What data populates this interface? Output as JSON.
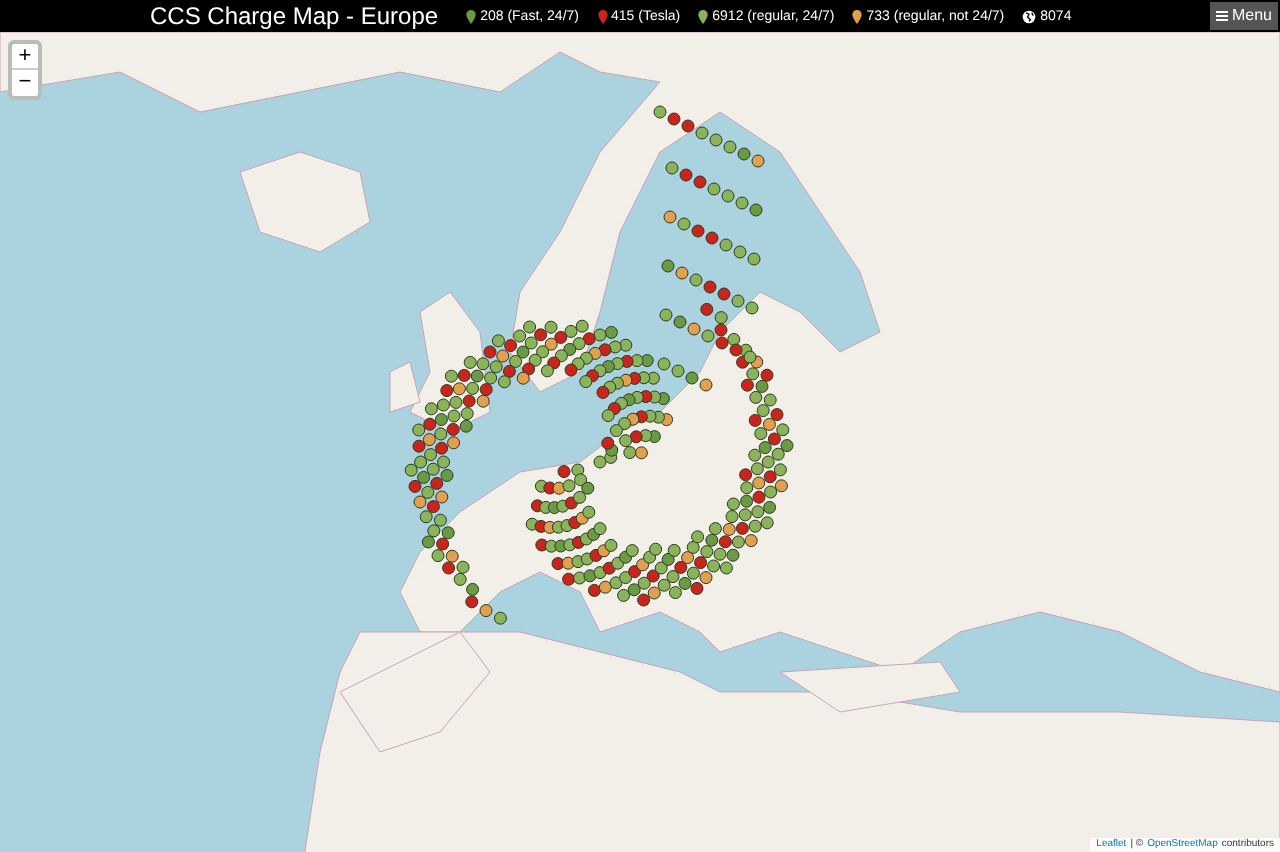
{
  "header": {
    "title": "CCS Charge Map - Europe",
    "legend": [
      {
        "kind": "pin",
        "color": "#6b9a45",
        "label": "208 (Fast, 24/7)"
      },
      {
        "kind": "pin",
        "color": "#c9251c",
        "label": "415 (Tesla)"
      },
      {
        "kind": "pin",
        "color": "#8bb35a",
        "label": "6912 (regular, 24/7)"
      },
      {
        "kind": "pin",
        "color": "#e0a050",
        "label": "733 (regular, not 24/7)"
      },
      {
        "kind": "globe",
        "color": "#ffffff",
        "label": "8074"
      }
    ],
    "menu": "Menu"
  },
  "zoom": {
    "in": "+",
    "out": "−"
  },
  "attribution": [
    {
      "kind": "link",
      "text": "Leaflet"
    },
    {
      "kind": "plain",
      "text": "| ©"
    },
    {
      "kind": "link",
      "text": "OpenStreetMap"
    },
    {
      "kind": "plain",
      "text": "contributors"
    }
  ]
}
